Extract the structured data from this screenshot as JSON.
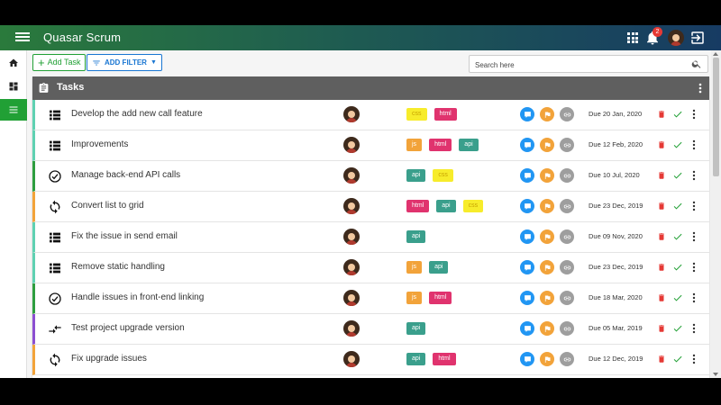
{
  "app": {
    "title": "Quasar Scrum",
    "notification_count": "2",
    "accent": "#21a035"
  },
  "toolbar": {
    "add_task_label": "Add Task",
    "add_filter_label": "ADD FILTER",
    "search_placeholder": "Search here"
  },
  "sidebar": {
    "items": [
      {
        "icon": "home-icon",
        "active": false
      },
      {
        "icon": "dashboard-icon",
        "active": false
      },
      {
        "icon": "list-icon",
        "active": true
      }
    ]
  },
  "panel": {
    "title": "Tasks"
  },
  "label_colors": {
    "css": "#f7ec2b",
    "html": "#e0336e",
    "js": "#f2a33a",
    "api": "#3a9f8c"
  },
  "tasks": [
    {
      "type": "list-icon",
      "bar": "#5fd1b2",
      "title": "Develop the add new call feature",
      "labels": [
        "css",
        "html"
      ],
      "due": "Due 20 Jan, 2020"
    },
    {
      "type": "list-icon",
      "bar": "#5fd1b2",
      "title": "Improvements",
      "labels": [
        "js",
        "html",
        "api"
      ],
      "due": "Due 12 Feb, 2020"
    },
    {
      "type": "check-circle-icon",
      "bar": "#2e9e3f",
      "title": "Manage back-end API calls",
      "labels": [
        "api",
        "css"
      ],
      "due": "Due 10 Jul, 2020"
    },
    {
      "type": "sync-icon",
      "bar": "#f2a33a",
      "title": "Convert list to grid",
      "labels": [
        "html",
        "api",
        "css"
      ],
      "due": "Due 23 Dec, 2019"
    },
    {
      "type": "list-icon",
      "bar": "#5fd1b2",
      "title": "Fix the issue in send email",
      "labels": [
        "api"
      ],
      "due": "Due 09 Nov, 2020"
    },
    {
      "type": "list-icon",
      "bar": "#5fd1b2",
      "title": "Remove static handling",
      "labels": [
        "js",
        "api"
      ],
      "due": "Due 23 Dec, 2019"
    },
    {
      "type": "check-circle-icon",
      "bar": "#2e9e3f",
      "title": "Handle issues in front-end linking",
      "labels": [
        "js",
        "html"
      ],
      "due": "Due 18 Mar, 2020"
    },
    {
      "type": "compare-arrows-icon",
      "bar": "#8c4fd1",
      "title": "Test project upgrade version",
      "labels": [
        "api"
      ],
      "due": "Due 05 Mar, 2019"
    },
    {
      "type": "sync-icon",
      "bar": "#f2a33a",
      "title": "Fix upgrade issues",
      "labels": [
        "api",
        "html"
      ],
      "due": "Due 12 Dec, 2019"
    }
  ]
}
